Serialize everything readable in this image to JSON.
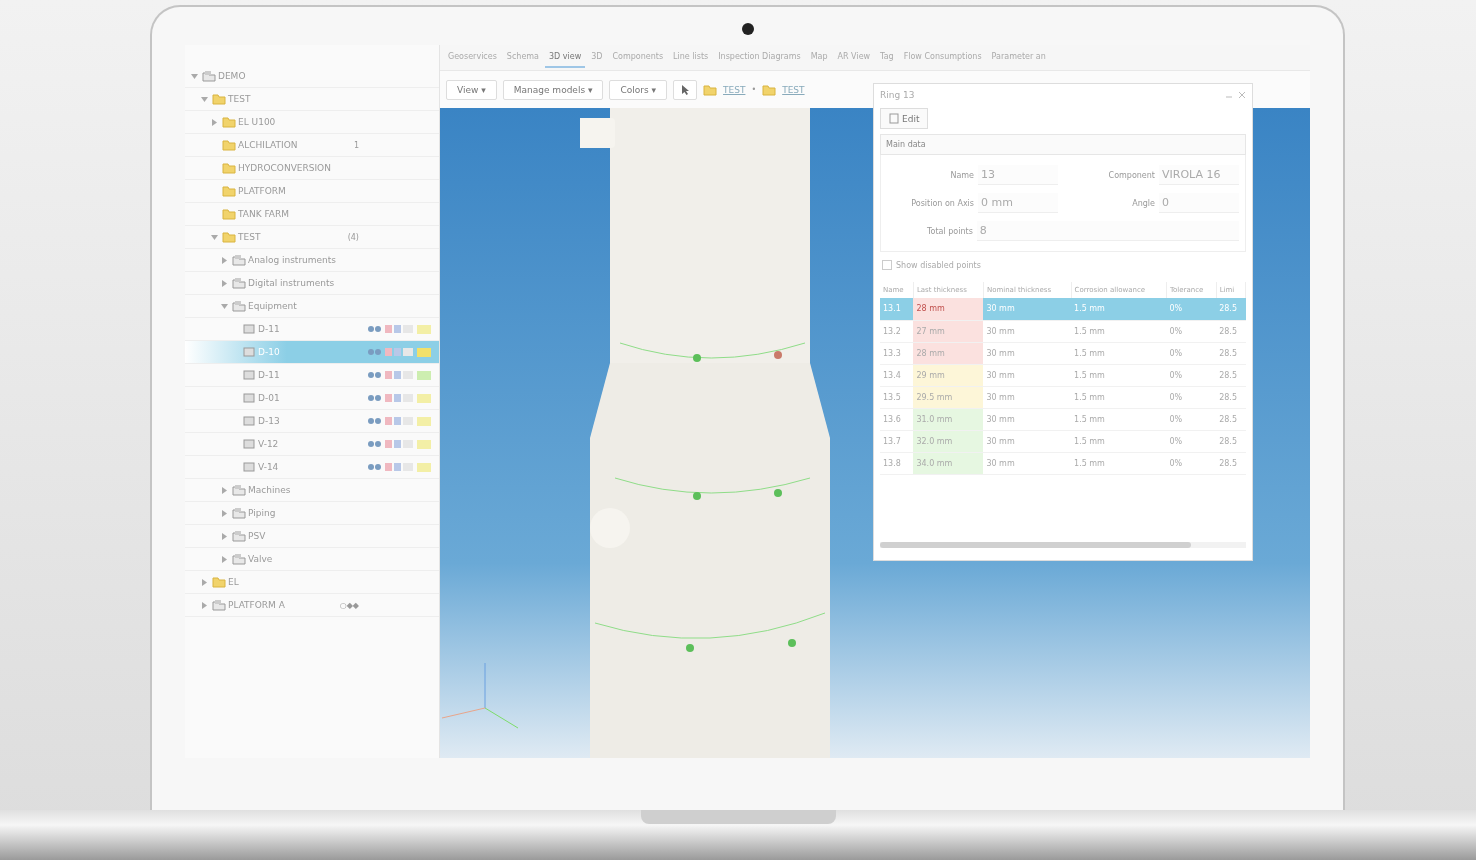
{
  "tree": [
    {
      "label": "DEMO",
      "kind": "group",
      "expanded": true,
      "children": [
        {
          "label": "TEST",
          "kind": "folder",
          "expanded": true,
          "children": [
            {
              "label": "EL U100",
              "kind": "folder",
              "expanded": false
            },
            {
              "label": "ALCHILATION",
              "kind": "folder",
              "badge": "1"
            },
            {
              "label": "HYDROCONVERSION",
              "kind": "folder"
            },
            {
              "label": "PLATFORM",
              "kind": "folder"
            },
            {
              "label": "TANK FARM",
              "kind": "folder"
            },
            {
              "label": "TEST",
              "kind": "folder",
              "badge": "(4)",
              "expanded": true,
              "children": [
                {
                  "label": "Analog instruments",
                  "kind": "group",
                  "expanded": false
                },
                {
                  "label": "Digital instruments",
                  "kind": "group",
                  "expanded": false
                },
                {
                  "label": "Equipment",
                  "kind": "group",
                  "expanded": true,
                  "children": [
                    {
                      "label": "D-11",
                      "kind": "equipment",
                      "selected": false,
                      "color": "#f3efa6"
                    },
                    {
                      "label": "D-10",
                      "kind": "equipment",
                      "selected": true,
                      "color": "#f1e06a"
                    },
                    {
                      "label": "D-11",
                      "kind": "equipment",
                      "selected": false,
                      "color": "#cdeeb0"
                    },
                    {
                      "label": "D-01",
                      "kind": "equipment",
                      "selected": false,
                      "color": "#f3efa6"
                    },
                    {
                      "label": "D-13",
                      "kind": "equipment",
                      "selected": false,
                      "color": "#f3efa6"
                    },
                    {
                      "label": "V-12",
                      "kind": "equipment",
                      "selected": false,
                      "color": "#f3efa6"
                    },
                    {
                      "label": "V-14",
                      "kind": "equipment",
                      "selected": false,
                      "color": "#f3efa6"
                    }
                  ]
                },
                {
                  "label": "Machines",
                  "kind": "group",
                  "expanded": false
                },
                {
                  "label": "Piping",
                  "kind": "group",
                  "expanded": false
                },
                {
                  "label": "PSV",
                  "kind": "group",
                  "expanded": false
                },
                {
                  "label": "Valve",
                  "kind": "group",
                  "expanded": false
                }
              ]
            }
          ]
        },
        {
          "label": "EL",
          "kind": "folder",
          "expanded": false
        },
        {
          "label": "PLATFORM A",
          "kind": "group",
          "expanded": false,
          "badge": "○◆◆"
        }
      ]
    }
  ],
  "tabs": [
    {
      "label": "Geoservices",
      "selected": false
    },
    {
      "label": "Schema",
      "selected": false
    },
    {
      "label": "3D view",
      "selected": true
    },
    {
      "label": "3D",
      "selected": false
    },
    {
      "label": "Components",
      "selected": false
    },
    {
      "label": "Line lists",
      "selected": false
    },
    {
      "label": "Inspection Diagrams",
      "selected": false
    },
    {
      "label": "Map",
      "selected": false
    },
    {
      "label": "AR View",
      "selected": false
    },
    {
      "label": "Tag",
      "selected": false
    },
    {
      "label": "Flow Consumptions",
      "selected": false
    },
    {
      "label": "Parameter an",
      "selected": false
    }
  ],
  "toolbar": {
    "buttons": [
      "View ▾",
      "Manage models ▾",
      "Colors ▾"
    ],
    "breadcrumb": [
      "TEST",
      "TEST"
    ],
    "breadcrumb_separator": "•"
  },
  "dialog": {
    "title": "Ring 13",
    "edit_button": "Edit",
    "section": "Main data",
    "fields": [
      {
        "label": "Name",
        "value": "13"
      },
      {
        "label": "Component",
        "value": "VIROLA 16"
      },
      {
        "label": "Position on Axis",
        "value": "0 mm"
      },
      {
        "label": "Angle",
        "value": "0"
      },
      {
        "label": "Total points",
        "value": "8"
      }
    ],
    "show_disabled": {
      "label": "Show disabled points",
      "checked": false
    },
    "table": {
      "columns": [
        "Name",
        "Last thickness",
        "Nominal thickness",
        "Corrosion allowance",
        "Tolerance",
        "Limi"
      ],
      "rows": [
        {
          "cells": [
            "13.1",
            "28 mm",
            "30 mm",
            "1.5 mm",
            "0%",
            "28.5"
          ],
          "selected": true,
          "color": "#fbe1df"
        },
        {
          "cells": [
            "13.2",
            "27 mm",
            "30 mm",
            "1.5 mm",
            "0%",
            "28.5"
          ],
          "selected": false,
          "color": "#fbe1df"
        },
        {
          "cells": [
            "13.3",
            "28 mm",
            "30 mm",
            "1.5 mm",
            "0%",
            "28.5"
          ],
          "selected": false,
          "color": "#fbe1df"
        },
        {
          "cells": [
            "13.4",
            "29 mm",
            "30 mm",
            "1.5 mm",
            "0%",
            "28.5"
          ],
          "selected": false,
          "color": "#fdf6d8"
        },
        {
          "cells": [
            "13.5",
            "29.5 mm",
            "30 mm",
            "1.5 mm",
            "0%",
            "28.5"
          ],
          "selected": false,
          "color": "#fdf6d8"
        },
        {
          "cells": [
            "13.6",
            "31.0 mm",
            "30 mm",
            "1.5 mm",
            "0%",
            "28.5"
          ],
          "selected": false,
          "color": "#e6f7e1"
        },
        {
          "cells": [
            "13.7",
            "32.0 mm",
            "30 mm",
            "1.5 mm",
            "0%",
            "28.5"
          ],
          "selected": false,
          "color": "#e6f7e1"
        },
        {
          "cells": [
            "13.8",
            "34.0 mm",
            "30 mm",
            "1.5 mm",
            "0%",
            "28.5"
          ],
          "selected": false,
          "color": "#e6f7e1"
        }
      ]
    }
  }
}
